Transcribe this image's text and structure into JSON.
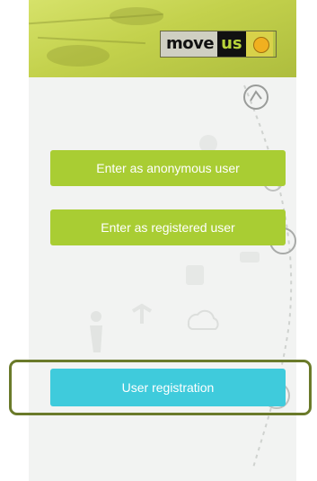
{
  "header": {
    "logo": {
      "word1": "move",
      "word2": "us"
    }
  },
  "buttons": {
    "anonymous_label": "Enter as anonymous user",
    "registered_label": "Enter as registered user",
    "registration_label": "User registration"
  },
  "colors": {
    "header_green": "#c3d14c",
    "button_green": "#a9cd33",
    "button_cyan": "#3fcbdc",
    "highlight_border": "#6a7a2a",
    "background": "#f2f3f2"
  },
  "icons": [
    "moveus-logo-icon",
    "route-line-icon",
    "walking-person-icon",
    "signpost-icon",
    "cloud-icon"
  ]
}
